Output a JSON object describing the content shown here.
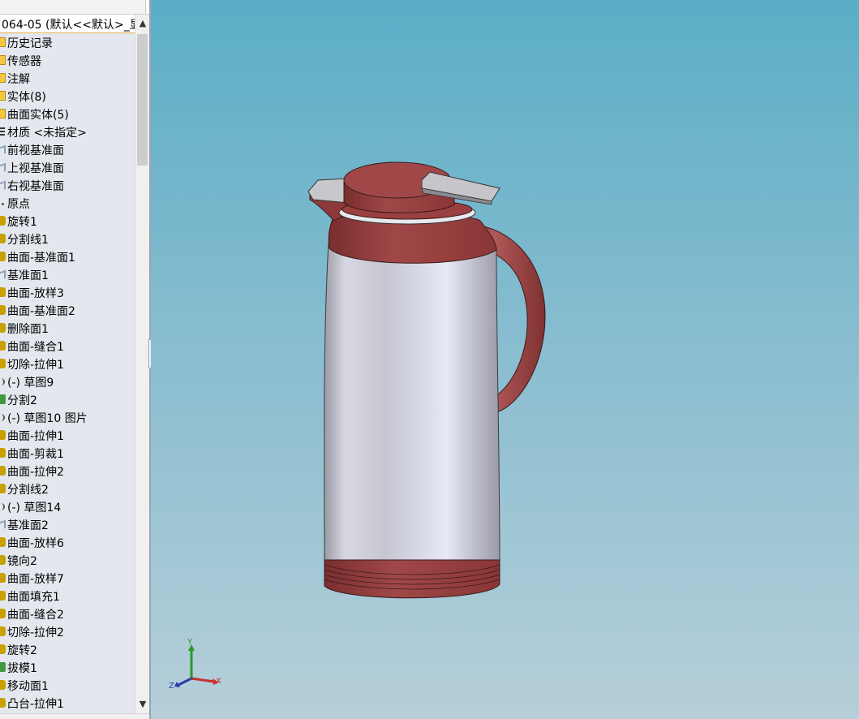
{
  "feature_tree": {
    "header_title": "064-05 (默认<<默认>_显",
    "items": [
      {
        "label": "历史记录",
        "icon": "folder-icon",
        "icon_class": "folder"
      },
      {
        "label": "传感器",
        "icon": "sensor-icon",
        "icon_class": "folder"
      },
      {
        "label": "注解",
        "icon": "annotation-icon",
        "icon_class": "folder"
      },
      {
        "label": "实体(8)",
        "icon": "solid-bodies-icon",
        "icon_class": "folder"
      },
      {
        "label": "曲面实体(5)",
        "icon": "surface-bodies-icon",
        "icon_class": "folder"
      },
      {
        "label": "材质 <未指定>",
        "icon": "material-icon",
        "icon_class": "list"
      },
      {
        "label": "前视基准面",
        "icon": "plane-icon",
        "icon_class": "plane"
      },
      {
        "label": "上视基准面",
        "icon": "plane-icon",
        "icon_class": "plane"
      },
      {
        "label": "右视基准面",
        "icon": "plane-icon",
        "icon_class": "plane"
      },
      {
        "label": "原点",
        "icon": "origin-icon",
        "icon_class": "dot"
      },
      {
        "label": "旋转1",
        "icon": "revolve-icon",
        "icon_class": "feat"
      },
      {
        "label": "分割线1",
        "icon": "split-line-icon",
        "icon_class": "feat"
      },
      {
        "label": "曲面-基准面1",
        "icon": "planar-surface-icon",
        "icon_class": "feat"
      },
      {
        "label": "基准面1",
        "icon": "plane-icon",
        "icon_class": "plane"
      },
      {
        "label": "曲面-放样3",
        "icon": "loft-surface-icon",
        "icon_class": "feat"
      },
      {
        "label": "曲面-基准面2",
        "icon": "planar-surface-icon",
        "icon_class": "feat"
      },
      {
        "label": "删除面1",
        "icon": "delete-face-icon",
        "icon_class": "feat"
      },
      {
        "label": "曲面-缝合1",
        "icon": "knit-surface-icon",
        "icon_class": "feat"
      },
      {
        "label": "切除-拉伸1",
        "icon": "extrude-cut-icon",
        "icon_class": "feat"
      },
      {
        "label": "(-) 草图9",
        "icon": "sketch-icon",
        "icon_class": "sketch"
      },
      {
        "label": "分割2",
        "icon": "split-icon",
        "icon_class": "green"
      },
      {
        "label": "(-) 草图10     图片",
        "icon": "sketch-icon",
        "icon_class": "sketch"
      },
      {
        "label": "曲面-拉伸1",
        "icon": "extrude-surface-icon",
        "icon_class": "feat"
      },
      {
        "label": "曲面-剪裁1",
        "icon": "trim-surface-icon",
        "icon_class": "feat"
      },
      {
        "label": "曲面-拉伸2",
        "icon": "extrude-surface-icon",
        "icon_class": "feat"
      },
      {
        "label": "分割线2",
        "icon": "split-line-icon",
        "icon_class": "feat"
      },
      {
        "label": "(-) 草图14",
        "icon": "sketch-icon",
        "icon_class": "sketch"
      },
      {
        "label": "基准面2",
        "icon": "plane-icon",
        "icon_class": "plane"
      },
      {
        "label": "曲面-放样6",
        "icon": "loft-surface-icon",
        "icon_class": "feat"
      },
      {
        "label": "镜向2",
        "icon": "mirror-icon",
        "icon_class": "feat"
      },
      {
        "label": "曲面-放样7",
        "icon": "loft-surface-icon",
        "icon_class": "feat"
      },
      {
        "label": "曲面填充1",
        "icon": "fill-surface-icon",
        "icon_class": "feat"
      },
      {
        "label": "曲面-缝合2",
        "icon": "knit-surface-icon",
        "icon_class": "feat"
      },
      {
        "label": "切除-拉伸2",
        "icon": "extrude-cut-icon",
        "icon_class": "feat"
      },
      {
        "label": "旋转2",
        "icon": "revolve-icon",
        "icon_class": "feat"
      },
      {
        "label": "拔模1",
        "icon": "draft-icon",
        "icon_class": "green"
      },
      {
        "label": "移动面1",
        "icon": "move-face-icon",
        "icon_class": "feat"
      },
      {
        "label": "凸台-拉伸1",
        "icon": "boss-extrude-icon",
        "icon_class": "feat"
      }
    ]
  },
  "scrollbar": {
    "up_icon": "▲",
    "down_icon": "▼"
  },
  "viewport": {
    "background_top": "#5aaec6",
    "background_bottom": "#b6cfd9",
    "body_color": "#c8c8d4",
    "accent_color": "#8e3a3a"
  },
  "triad": {
    "x_label": "X",
    "y_label": "Y",
    "z_label": "Z"
  }
}
